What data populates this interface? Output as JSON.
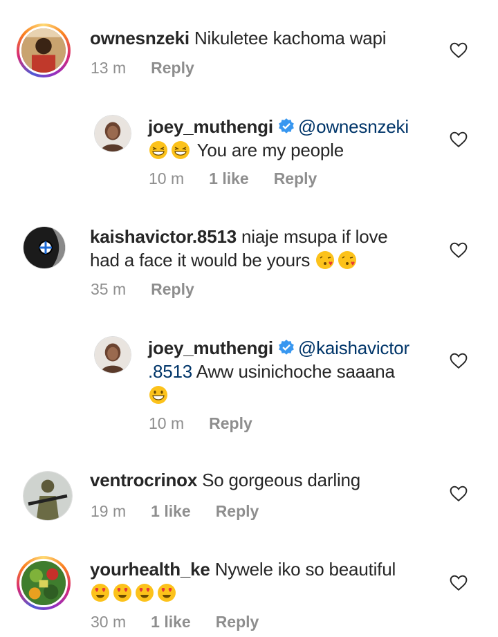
{
  "comments": [
    {
      "username": "ownesnzeki",
      "text": "Nikuletee kachoma wapi",
      "time": "13 m",
      "likes": "",
      "reply": "Reply"
    },
    {
      "username": "joey_muthengi",
      "mention": "@ownesnzeki",
      "text": "You are my people",
      "time": "10 m",
      "likes": "1 like",
      "reply": "Reply"
    },
    {
      "username": "kaishavictor.8513",
      "text_line1": "niaje msupa  if love",
      "text_line2": "had a face it would be yours",
      "time": "35 m",
      "likes": "",
      "reply": "Reply"
    },
    {
      "username": "joey_muthengi",
      "mention_line1": "@kaishavictor",
      "mention_line2": ".8513",
      "text": "Aww usinichoche saaana",
      "time": "10 m",
      "likes": "",
      "reply": "Reply"
    },
    {
      "username": "ventrocrinox",
      "text": "So gorgeous darling",
      "time": "19 m",
      "likes": "1 like",
      "reply": "Reply"
    },
    {
      "username": "yourhealth_ke",
      "text": "Nywele iko so beautiful",
      "time": "30 m",
      "likes": "1 like",
      "reply": "Reply"
    }
  ],
  "icons": {
    "verified": "verified-badge-icon",
    "like": "heart-outline-icon"
  },
  "colors": {
    "username": "#262626",
    "mention": "#003569",
    "meta": "#8e8e8e",
    "verified": "#3897f0"
  }
}
